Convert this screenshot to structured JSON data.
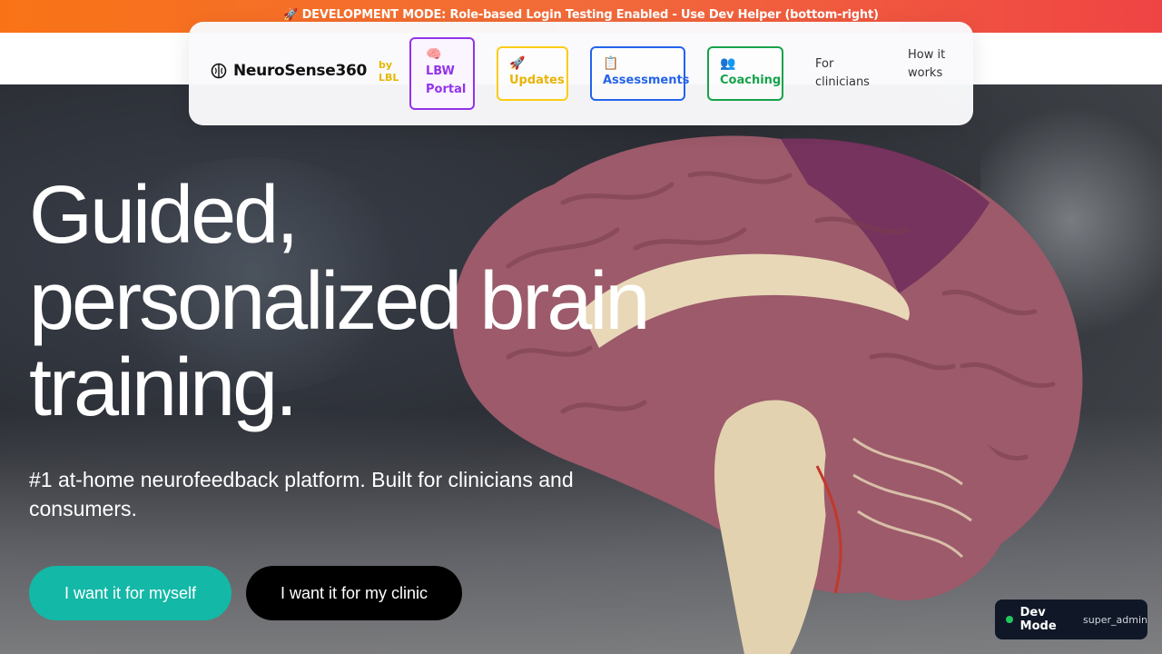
{
  "banner": {
    "text": "🚀 DEVELOPMENT MODE: Role-based Login Testing Enabled - Use Dev Helper (bottom-right)"
  },
  "nav": {
    "logo": "NeuroSense360",
    "logo_by": "by LBL",
    "buttons": [
      {
        "emoji": "🧠",
        "label": "LBW Portal",
        "color": "#9333ea"
      },
      {
        "emoji": "🚀",
        "label": "Updates",
        "color": "#eab308"
      },
      {
        "emoji": "📋",
        "label": "Assessments",
        "color": "#2563eb"
      },
      {
        "emoji": "👥",
        "label": "Coaching",
        "color": "#16a34a"
      }
    ],
    "links": [
      "For clinicians",
      "How it works"
    ]
  },
  "hero": {
    "title": "Guided, personalized brain training.",
    "subtitle": "#1 at-home neurofeedback platform. Built for clinicians and consumers.",
    "cta_self": "I want it for myself",
    "cta_clinic": "I want it for my clinic"
  },
  "dev_helper": {
    "label": "Dev Mode",
    "role": "super_admin",
    "status_color": "#22c55e"
  },
  "colors": {
    "teal": "#14b8a6",
    "banner_start": "#f97316",
    "banner_end": "#ef4444"
  }
}
